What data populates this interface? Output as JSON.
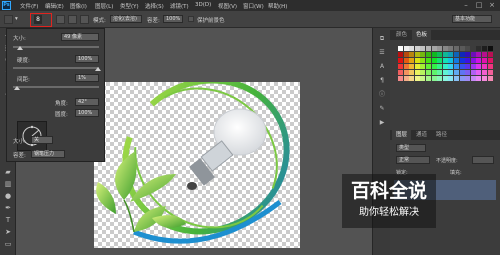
{
  "app": {
    "logo": "Ps"
  },
  "menubar": {
    "items": [
      "文件(F)",
      "编辑(E)",
      "图像(I)",
      "图层(L)",
      "类型(Y)",
      "选择(S)",
      "滤镜(T)",
      "3D(D)",
      "视图(V)",
      "窗口(W)",
      "帮助(H)"
    ]
  },
  "options": {
    "brush_size": "8",
    "mode_label": "模式:",
    "mode_value": "溶化(去溶)",
    "opacity_label": "容差:",
    "opacity_value": "100%",
    "checkbox_label": "保护前景色",
    "workspace": "基本功能"
  },
  "brush_panel": {
    "size_label": "大小:",
    "size_value": "49 像素",
    "hardness_label": "硬度:",
    "hardness_value": "100%",
    "spacing_label": "间距:",
    "spacing_value": "1%",
    "angle_label": "角度:",
    "angle_value": "42°",
    "roundness_label": "圆度:",
    "roundness_value": "100%",
    "size2_label": "大小:",
    "size2_value": "关",
    "tolerance_label": "容差:",
    "tolerance_value": "钢笔压力"
  },
  "right_panel": {
    "color_tabs": [
      "颜色",
      "色板"
    ],
    "layers_tabs": [
      "图层",
      "通道",
      "路径"
    ],
    "kind_filter": "类型",
    "blend_mode": "正常",
    "opacity_label": "不透明度:",
    "lock_label": "锁定:",
    "fill_label": "填充:"
  },
  "watermark": {
    "title": "百科全说",
    "subtitle": "助你轻松解决"
  },
  "colors": {
    "menubar": "#2d2d2d",
    "panel": "#3c3c3c",
    "workspace": "#535353",
    "highlight": "#e0241f"
  }
}
